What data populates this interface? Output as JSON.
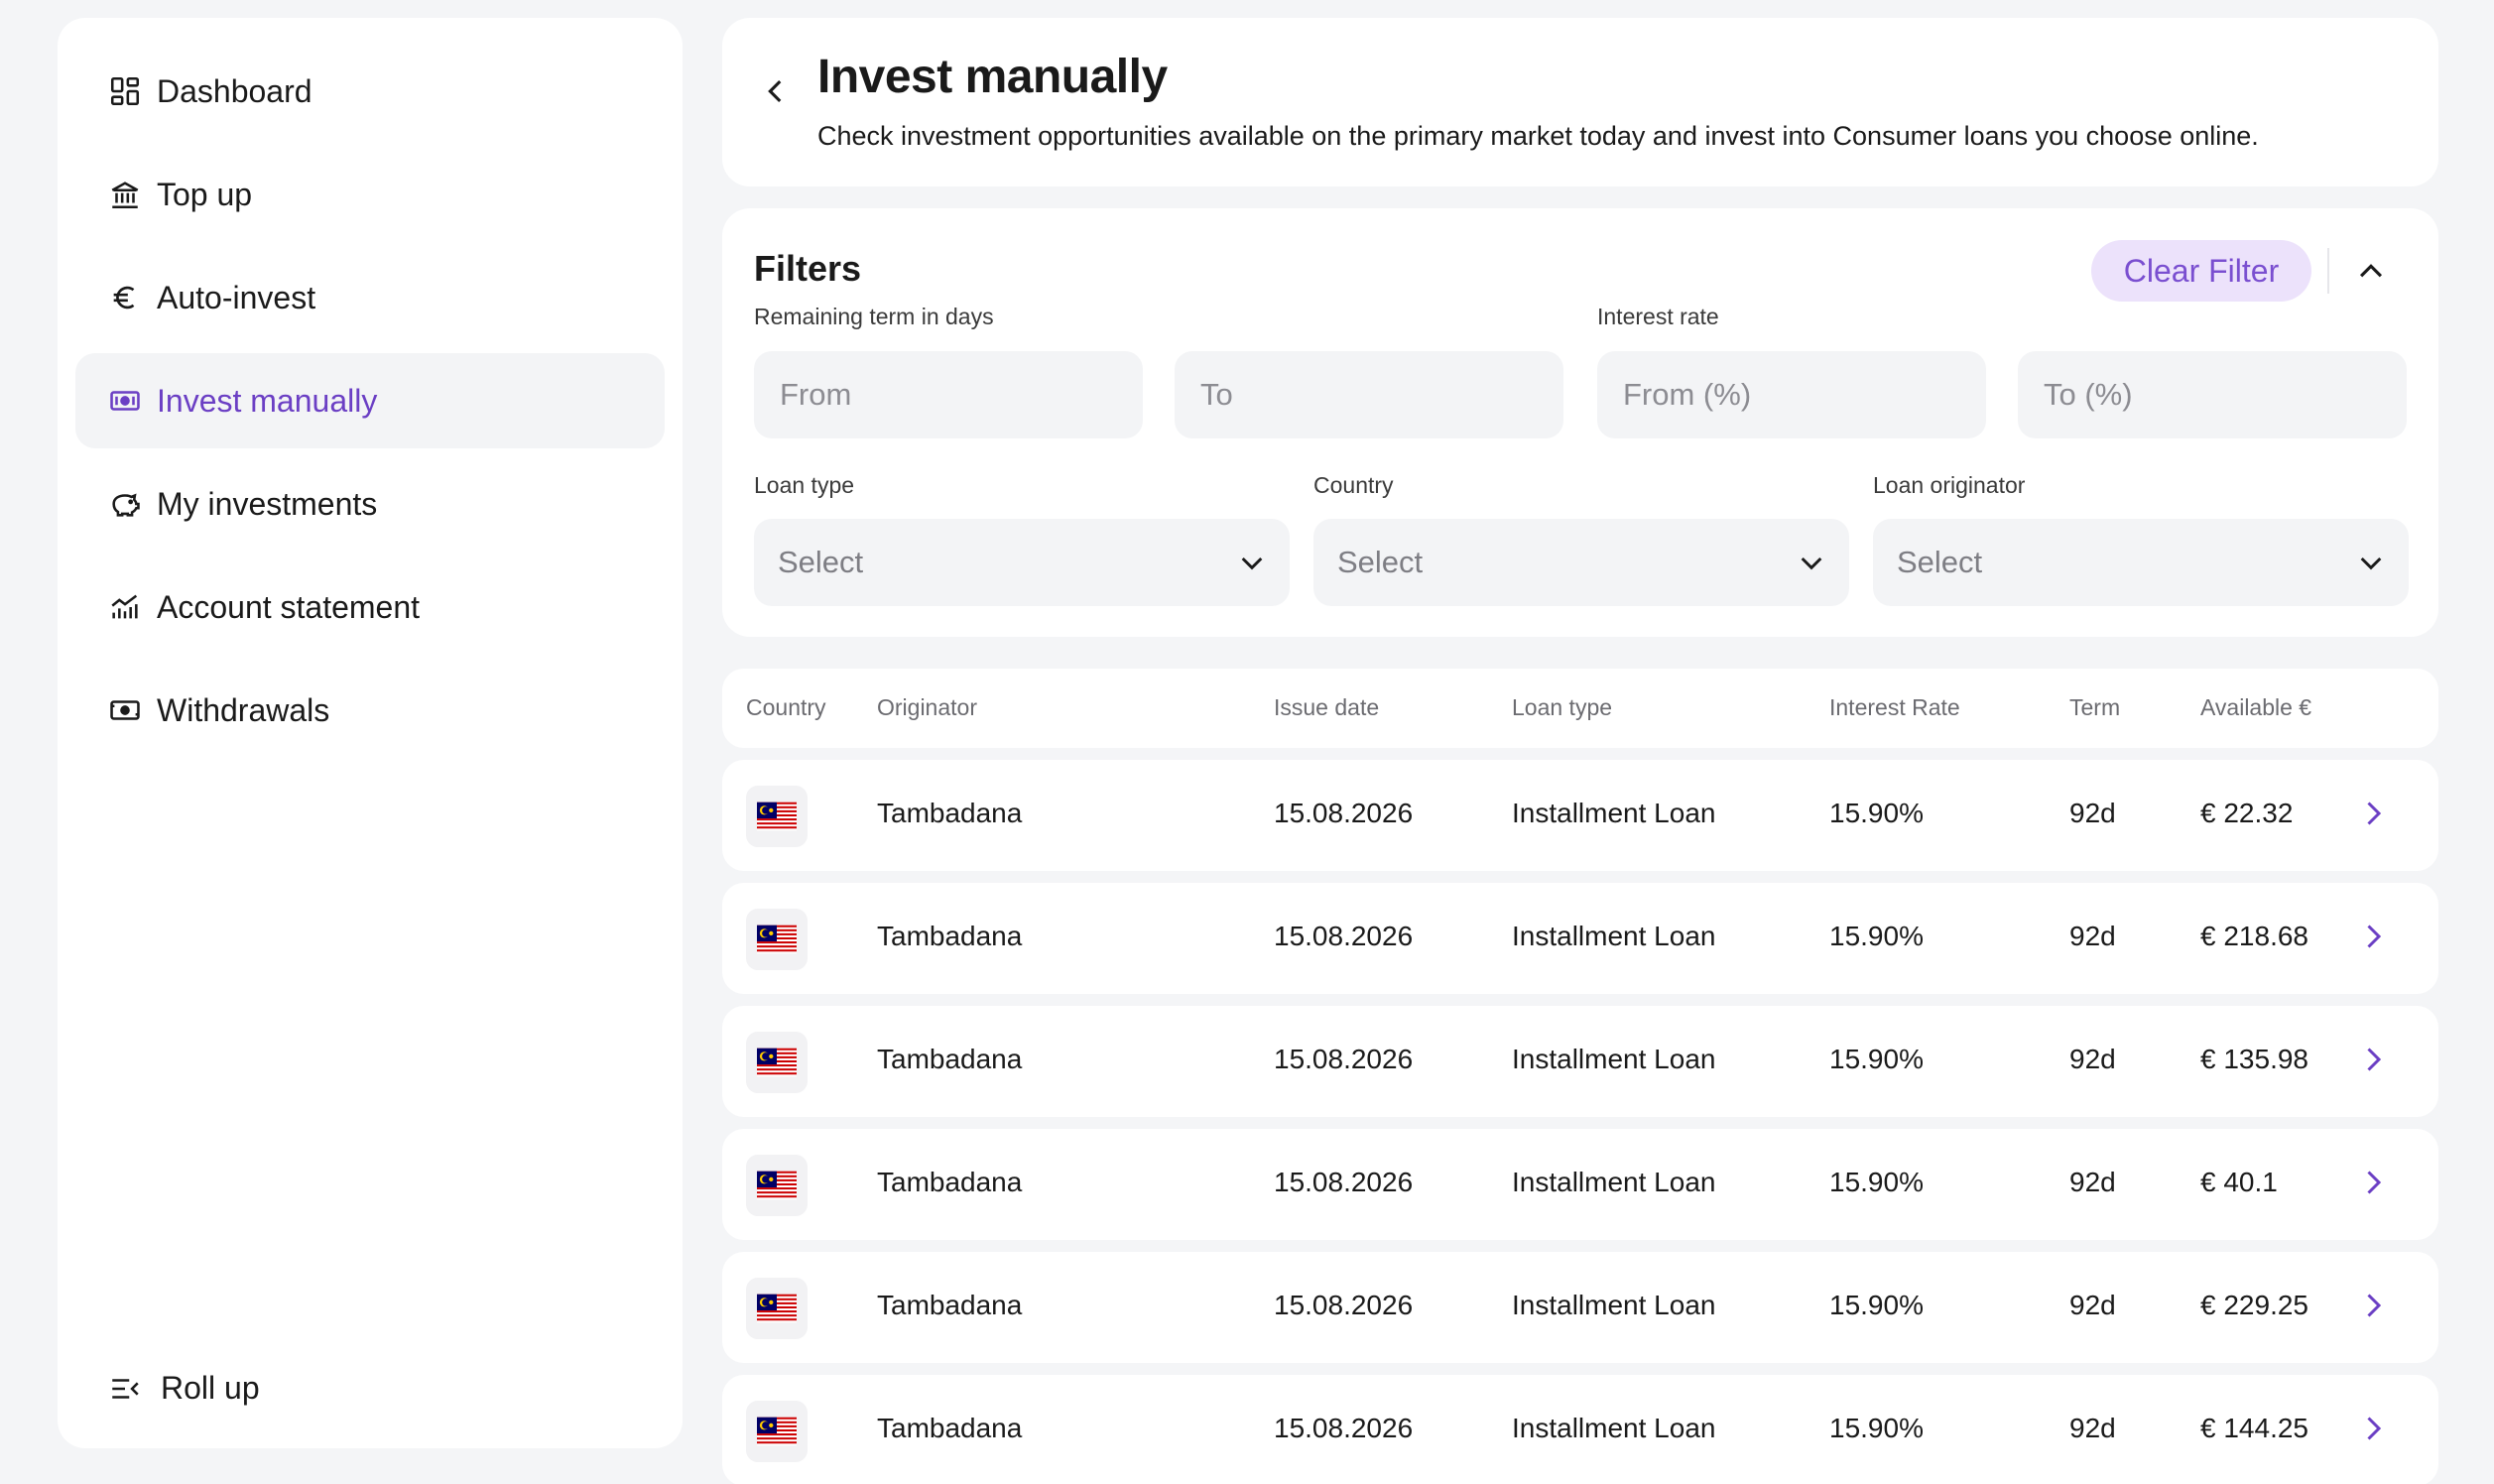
{
  "sidebar": {
    "items": [
      {
        "label": "Dashboard",
        "icon": "dashboard-icon",
        "active": false
      },
      {
        "label": "Top up",
        "icon": "bank-icon",
        "active": false
      },
      {
        "label": "Auto-invest",
        "icon": "euro-icon",
        "active": false
      },
      {
        "label": "Invest manually",
        "icon": "cash-icon",
        "active": true
      },
      {
        "label": "My investments",
        "icon": "piggy-bank-icon",
        "active": false
      },
      {
        "label": "Account statement",
        "icon": "chart-icon",
        "active": false
      },
      {
        "label": "Withdrawals",
        "icon": "wallet-icon",
        "active": false
      }
    ],
    "rollup_label": "Roll up"
  },
  "header": {
    "title": "Invest manually",
    "subtitle": "Check investment opportunities available on the primary market today and invest into Consumer loans you choose online."
  },
  "filters": {
    "title": "Filters",
    "clear_label": "Clear Filter",
    "term_label": "Remaining term in days",
    "term_from_placeholder": "From",
    "term_to_placeholder": "To",
    "rate_label": "Interest rate",
    "rate_from_placeholder": "From (%)",
    "rate_to_placeholder": "To (%)",
    "loan_type_label": "Loan type",
    "loan_type_value": "Select",
    "country_label": "Country",
    "country_value": "Select",
    "originator_label": "Loan originator",
    "originator_value": "Select"
  },
  "table": {
    "headers": {
      "country": "Country",
      "originator": "Originator",
      "issue_date": "Issue date",
      "loan_type": "Loan type",
      "interest_rate": "Interest Rate",
      "term": "Term",
      "available": "Available €"
    },
    "rows": [
      {
        "country": "Malaysia flag",
        "originator": "Tambadana",
        "issue_date": "15.08.2026",
        "loan_type": "Installment Loan",
        "interest_rate": "15.90%",
        "term": "92d",
        "available": "€ 22.32"
      },
      {
        "country": "Malaysia flag",
        "originator": "Tambadana",
        "issue_date": "15.08.2026",
        "loan_type": "Installment Loan",
        "interest_rate": "15.90%",
        "term": "92d",
        "available": "€ 218.68"
      },
      {
        "country": "Malaysia flag",
        "originator": "Tambadana",
        "issue_date": "15.08.2026",
        "loan_type": "Installment Loan",
        "interest_rate": "15.90%",
        "term": "92d",
        "available": "€ 135.98"
      },
      {
        "country": "Malaysia flag",
        "originator": "Tambadana",
        "issue_date": "15.08.2026",
        "loan_type": "Installment Loan",
        "interest_rate": "15.90%",
        "term": "92d",
        "available": "€ 40.1"
      },
      {
        "country": "Malaysia flag",
        "originator": "Tambadana",
        "issue_date": "15.08.2026",
        "loan_type": "Installment Loan",
        "interest_rate": "15.90%",
        "term": "92d",
        "available": "€ 229.25"
      },
      {
        "country": "Malaysia flag",
        "originator": "Tambadana",
        "issue_date": "15.08.2026",
        "loan_type": "Installment Loan",
        "interest_rate": "15.90%",
        "term": "92d",
        "available": "€ 144.25"
      }
    ]
  },
  "colors": {
    "accent": "#6b3fc4",
    "clear_filter_bg": "#ece2fb",
    "clear_filter_text": "#7a4fd0",
    "background": "#f4f5f7",
    "card": "#ffffff"
  }
}
